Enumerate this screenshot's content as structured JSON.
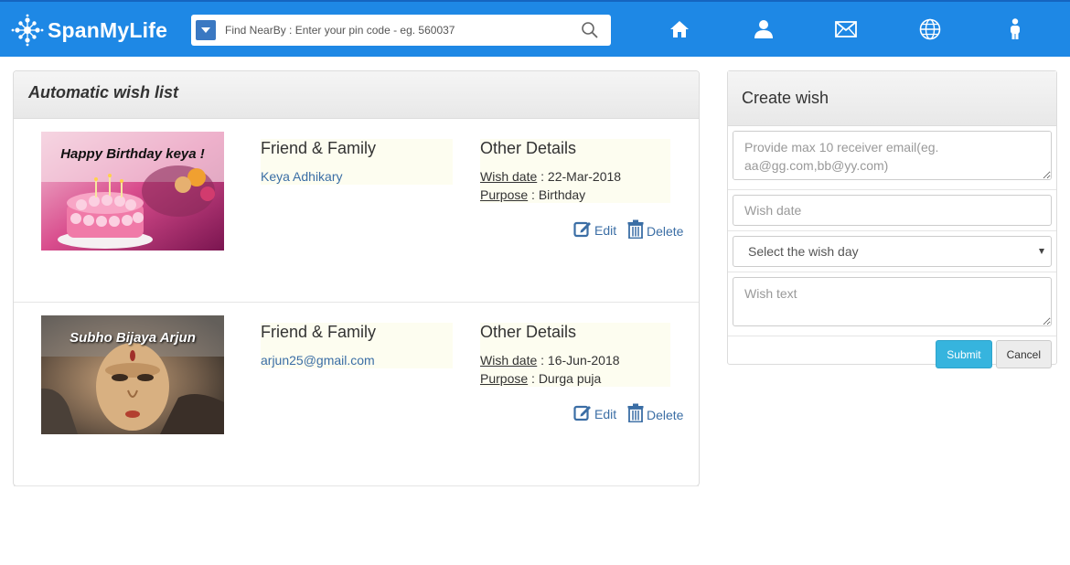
{
  "brand": {
    "name": "SpanMyLife"
  },
  "search": {
    "placeholder": "Find NearBy : Enter your pin code - eg. 560037"
  },
  "nav": {
    "icons": [
      "home-icon",
      "user-icon",
      "envelope-icon",
      "globe-icon",
      "person-icon"
    ]
  },
  "colors": {
    "navbar": "#1e88e5",
    "link": "#3b6ea5",
    "submit": "#36b4de"
  },
  "wish_list": {
    "title": "Automatic wish list",
    "items": [
      {
        "image_caption": "Happy Birthday keya !",
        "group_title": "Friend & Family",
        "recipient": "Keya Adhikary",
        "details_title": "Other Details",
        "date_label": "Wish date",
        "date_value": " : 22-Mar-2018",
        "purpose_label": "Purpose",
        "purpose_value": " : Birthday",
        "edit_label": "Edit",
        "delete_label": "Delete"
      },
      {
        "image_caption": "Subho Bijaya Arjun",
        "group_title": "Friend & Family",
        "recipient": "arjun25@gmail.com",
        "details_title": "Other Details",
        "date_label": "Wish date",
        "date_value": " : 16-Jun-2018",
        "purpose_label": "Purpose",
        "purpose_value": " : Durga puja",
        "edit_label": "Edit",
        "delete_label": "Delete"
      }
    ]
  },
  "create_wish": {
    "title": "Create wish",
    "email_placeholder": "Provide max 10 receiver email(eg. aa@gg.com,bb@yy.com)",
    "date_placeholder": "Wish date",
    "day_select": "Select the wish day",
    "text_placeholder": "Wish text",
    "submit_label": "Submit",
    "cancel_label": "Cancel"
  }
}
